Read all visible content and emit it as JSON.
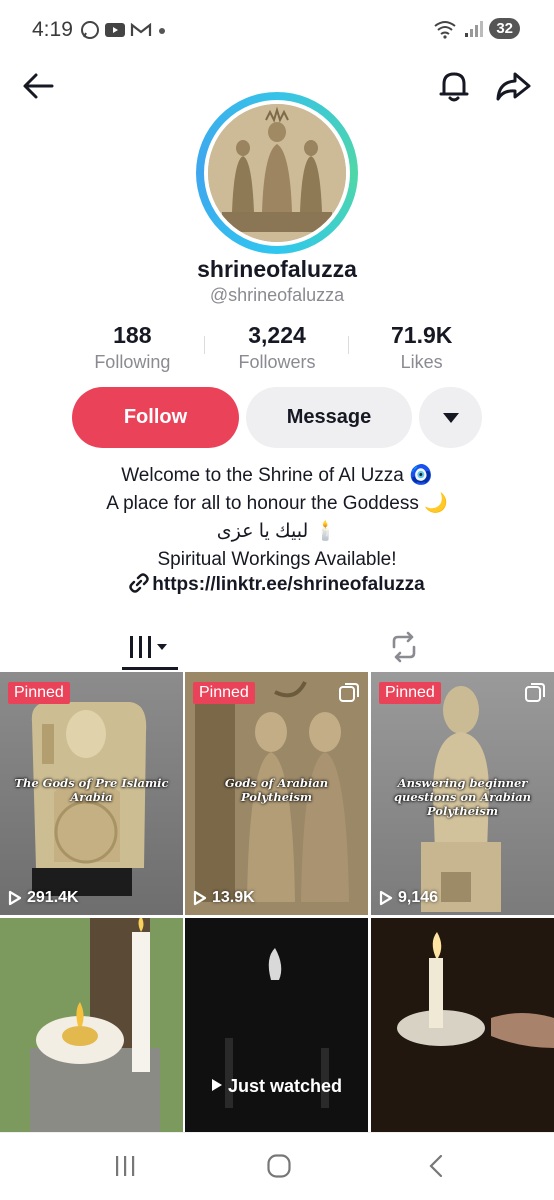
{
  "status_bar": {
    "time": "4:19",
    "battery": "32",
    "left_icons": [
      "whatsapp-icon",
      "youtube-icon",
      "gmail-icon",
      "dot-icon"
    ],
    "right_icons": [
      "wifi-icon",
      "signal-icon",
      "battery-icon"
    ]
  },
  "nav": {
    "icons": [
      "back-arrow-icon",
      "bell-icon",
      "share-icon"
    ]
  },
  "profile": {
    "display_name": "shrineofaluzza",
    "username": "@shrineofaluzza",
    "stats": [
      {
        "value": "188",
        "label": "Following"
      },
      {
        "value": "3,224",
        "label": "Followers"
      },
      {
        "value": "71.9K",
        "label": "Likes"
      }
    ],
    "follow_label": "Follow",
    "message_label": "Message",
    "bio": [
      "Welcome to the Shrine of Al Uzza 🧿",
      "A place for all to honour the Goddess 🌙",
      "لبيك يا عزى 🕯️",
      "Spiritual Workings Available!"
    ],
    "link": "https://linktr.ee/shrineofaluzza"
  },
  "tabs": {
    "icons": [
      "videos-grid-icon",
      "repost-icon"
    ],
    "selected": "videos"
  },
  "videos": [
    {
      "pinned": "Pinned",
      "title": "The Gods of Pre Islamic Arabia",
      "views": "291.4K"
    },
    {
      "pinned": "Pinned",
      "title": "Gods of Arabian Polytheism",
      "views": "13.9K"
    },
    {
      "pinned": "Pinned",
      "title": "Answering beginner questions on Arabian Polytheism",
      "views": "9,146"
    },
    {
      "views": ""
    },
    {
      "label": "Just watched"
    },
    {
      "views": ""
    }
  ],
  "colors": {
    "accent": "#ea4359",
    "text": "#161823",
    "muted": "#8a8b91",
    "button_bg": "#efeff1"
  }
}
